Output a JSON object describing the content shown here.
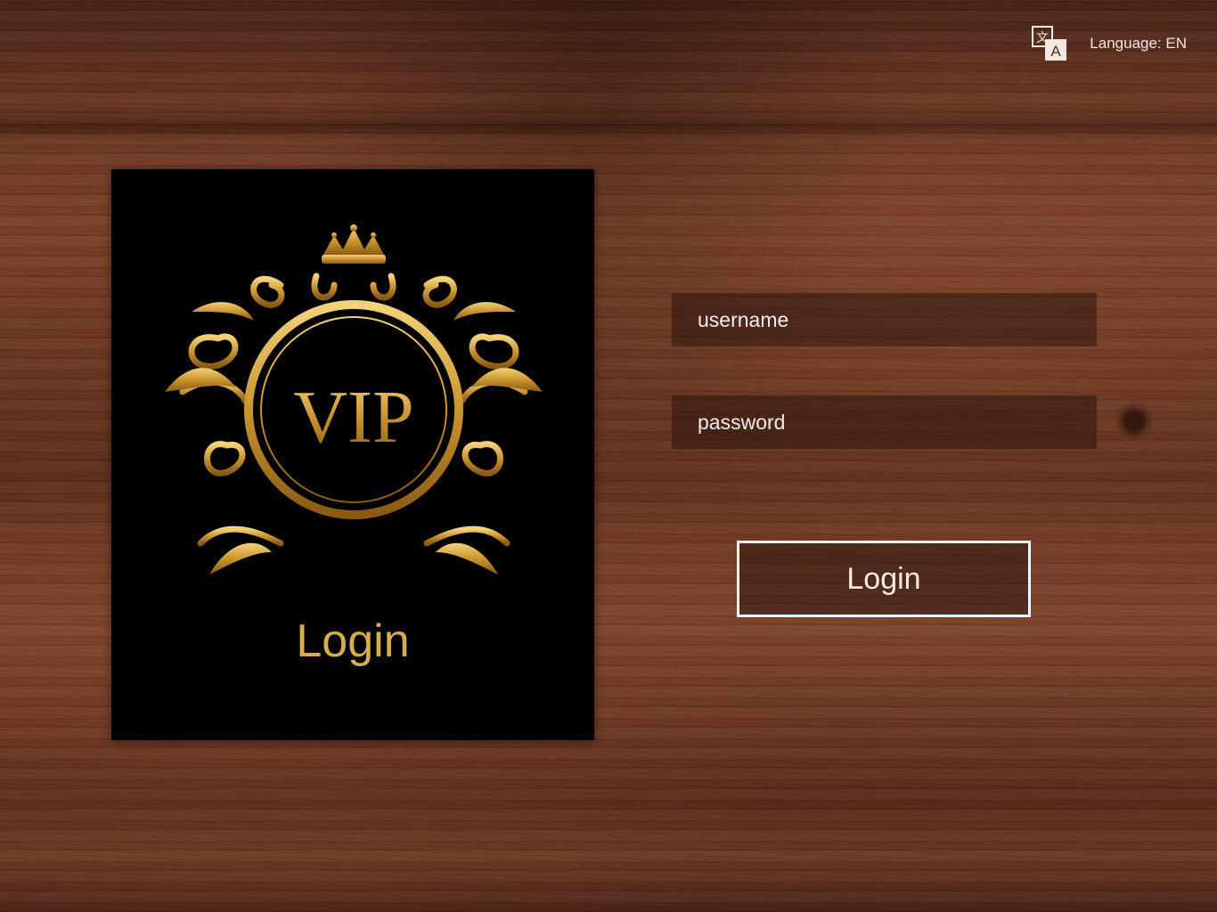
{
  "header": {
    "language_label": "Language: EN",
    "language_icon": "translate-icon"
  },
  "card": {
    "emblem_text": "VIP",
    "title": "Login"
  },
  "form": {
    "username_placeholder": "username",
    "password_placeholder": "password",
    "submit_label": "Login"
  },
  "colors": {
    "gold": "#d7ae4d",
    "card_bg": "#000000",
    "text_light": "#f3ece7"
  }
}
